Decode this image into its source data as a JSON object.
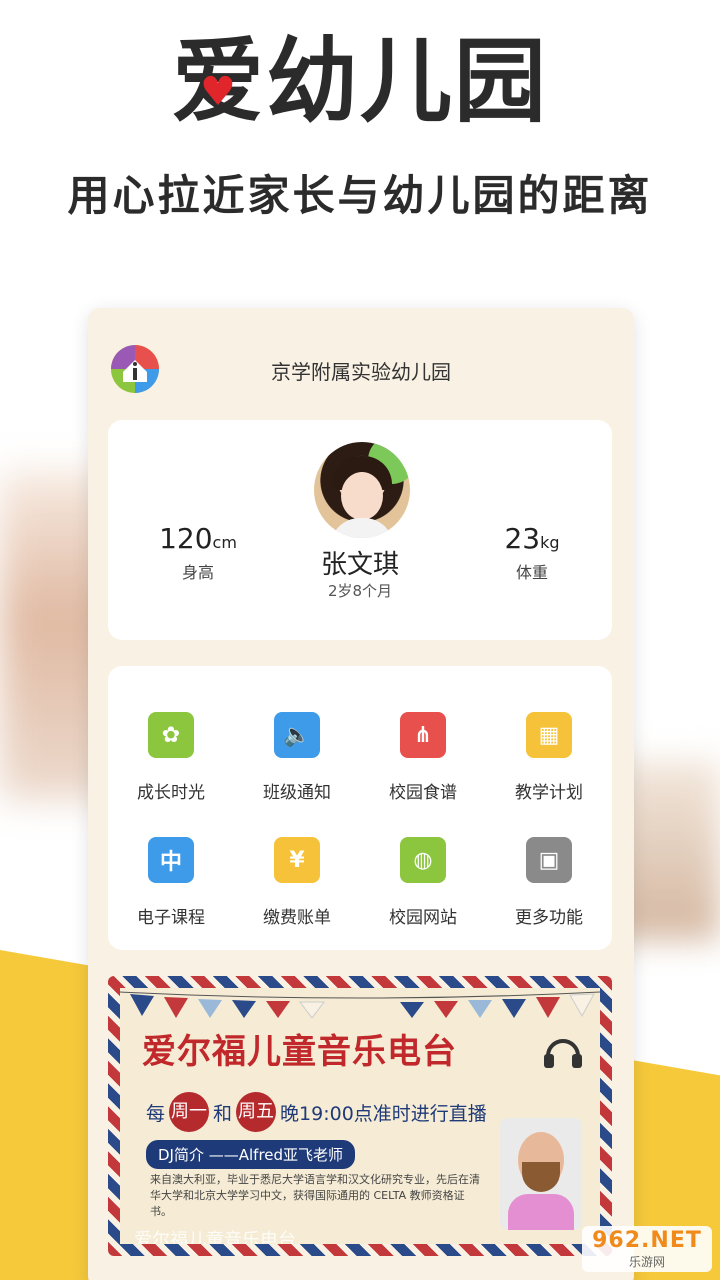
{
  "header": {
    "logo_char_1": "爱",
    "logo_rest": "幼儿园",
    "slogan": "用心拉近家长与幼儿园的距离"
  },
  "app": {
    "school_name": "京学附属实验幼儿园"
  },
  "profile": {
    "height_value": "120",
    "height_unit": "cm",
    "height_label": "身高",
    "weight_value": "23",
    "weight_unit": "kg",
    "weight_label": "体重",
    "name": "张文琪",
    "age": "2岁8个月"
  },
  "functions": [
    {
      "label": "成长时光",
      "icon": "sprout-icon",
      "color": "#8cc63f",
      "glyph": "✿"
    },
    {
      "label": "班级通知",
      "icon": "speaker-icon",
      "color": "#3d9be9",
      "glyph": "🔈"
    },
    {
      "label": "校园食谱",
      "icon": "utensils-icon",
      "color": "#e8504d",
      "glyph": "⋔"
    },
    {
      "label": "教学计划",
      "icon": "calendar-icon",
      "color": "#f5c23a",
      "glyph": "▦"
    },
    {
      "label": "电子课程",
      "icon": "translate-icon",
      "color": "#3d9be9",
      "glyph": "中"
    },
    {
      "label": "缴费账单",
      "icon": "bill-icon",
      "color": "#f5c23a",
      "glyph": "¥"
    },
    {
      "label": "校园网站",
      "icon": "globe-icon",
      "color": "#8cc63f",
      "glyph": "◍"
    },
    {
      "label": "更多功能",
      "icon": "grid-icon",
      "color": "#8a8a8a",
      "glyph": "▣"
    }
  ],
  "banner": {
    "title": "爱尔福儿童音乐电台",
    "schedule_prefix": "每",
    "day1": "周一",
    "and": "和",
    "day2": "周五",
    "schedule_suffix": "晚19:00点准时进行直播",
    "dj_tag": "DJ简介 ——Alfred亚飞老师",
    "dj_desc": "来自澳大利亚，毕业于悉尼大学语言学和汉文化研究专业，先后在清华大学和北京大学学习中文，获得国际通用的 CELTA 教师资格证书。",
    "caption": "爱尔福儿童音乐电台"
  },
  "watermark": {
    "line1": "962.NET",
    "line2": "乐游网"
  }
}
